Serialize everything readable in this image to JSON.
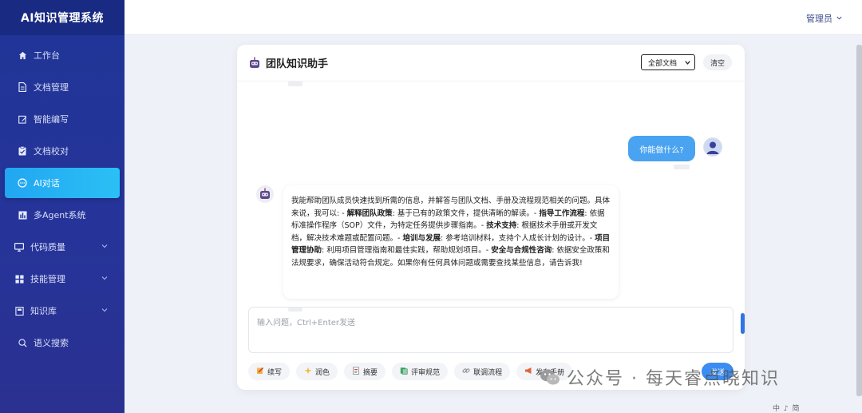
{
  "app": {
    "title": "AI知识管理系统"
  },
  "header": {
    "user_label": "管理员"
  },
  "sidebar": {
    "items": [
      {
        "label": "工作台",
        "icon": "home-icon"
      },
      {
        "label": "文档管理",
        "icon": "document-icon"
      },
      {
        "label": "智能编写",
        "icon": "edit-icon"
      },
      {
        "label": "文档校对",
        "icon": "clipboard-check-icon"
      },
      {
        "label": "AI对话",
        "icon": "chat-icon",
        "active": true
      },
      {
        "label": "多Agent系统",
        "icon": "bar-chart-icon"
      },
      {
        "label": "代码质量",
        "icon": "monitor-icon",
        "expandable": true
      },
      {
        "label": "技能管理",
        "icon": "grid-icon",
        "expandable": true
      },
      {
        "label": "知识库",
        "icon": "book-icon",
        "expandable": true
      },
      {
        "label": "语义搜索",
        "icon": "search-icon"
      }
    ]
  },
  "chat": {
    "title": "团队知识助手",
    "doc_filter": {
      "selected": "全部文档"
    },
    "clear_label": "清空",
    "user_message": "你能做什么?",
    "assistant_message": {
      "intro": "我能帮助团队成员快速找到所需的信息，并解答与团队文档、手册及流程规范相关的问题。具体来说，我可以: - ",
      "items": [
        {
          "title": "解释团队政策",
          "text": ": 基于已有的政策文件，提供清晰的解读。- "
        },
        {
          "title": "指导工作流程",
          "text": ": 依据标准操作程序（SOP）文件，为特定任务提供步骤指南。- "
        },
        {
          "title": "技术支持",
          "text": ": 根据技术手册或开发文档，解决技术难题或配置问题。- "
        },
        {
          "title": "培训与发展",
          "text": ": 参考培训材料，支持个人成长计划的设计。- "
        },
        {
          "title": "项目管理协助",
          "text": ": 利用项目管理指南和最佳实践，帮助规划项目。- "
        },
        {
          "title": "安全与合规性咨询",
          "text": ": 依据安全政策和法规要求，确保活动符合规定。"
        }
      ],
      "outro": "如果你有任何具体问题或需要查找某些信息，请告诉我!"
    },
    "input_placeholder": "输入问题，Ctrl+Enter发送",
    "tools": [
      {
        "label": "续写",
        "icon": "pencil-icon"
      },
      {
        "label": "润色",
        "icon": "sparkle-icon"
      },
      {
        "label": "摘要",
        "icon": "note-icon"
      },
      {
        "label": "评审规范",
        "icon": "review-icon"
      },
      {
        "label": "联调流程",
        "icon": "link-icon"
      },
      {
        "label": "发布手册",
        "icon": "megaphone-icon"
      }
    ],
    "send_label": "发送"
  },
  "watermark": {
    "text": "公众号 · 每天睿点晓知识"
  },
  "tray": {
    "text": "中 ♪ 简"
  },
  "colors": {
    "sidebar": "#22349a",
    "active": "#27b4f4",
    "accent": "#3c8df1"
  }
}
